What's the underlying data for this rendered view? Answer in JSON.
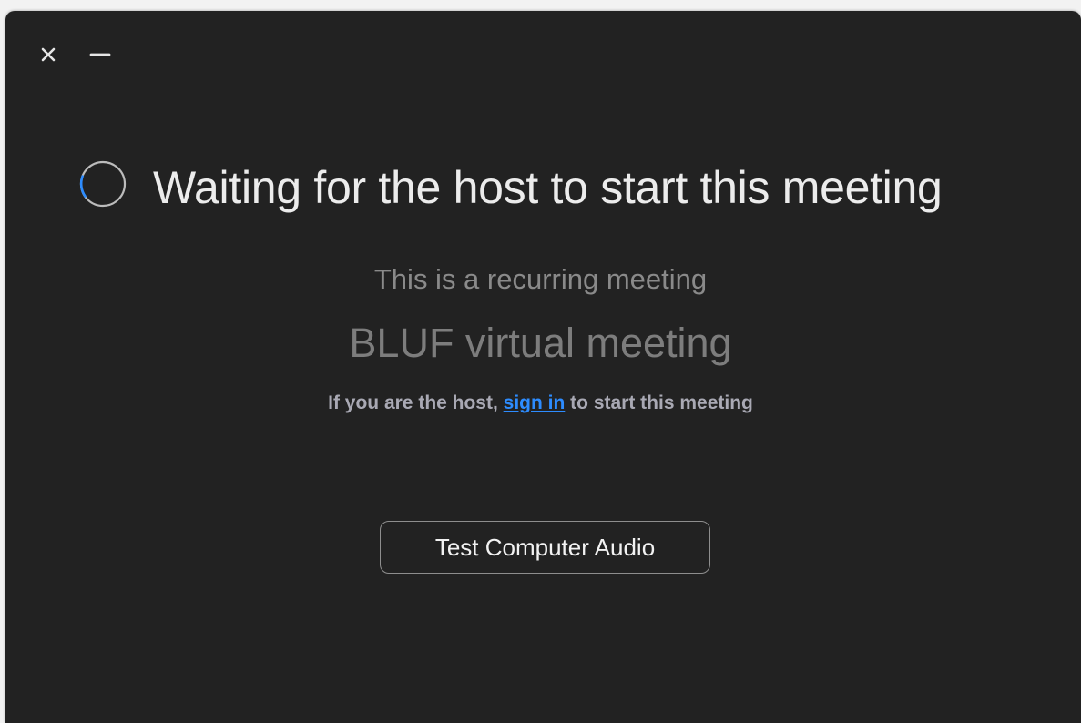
{
  "window": {
    "controls": {
      "close_icon": "close-icon",
      "minimize_icon": "minimize-icon"
    }
  },
  "main": {
    "spinner_icon": "loading-spinner-icon",
    "headline": "Waiting for the host to start this meeting",
    "recurring_text": "This is a recurring meeting",
    "meeting_name": "BLUF virtual meeting",
    "host_prefix": "If you are the host, ",
    "sign_in_link": "sign in",
    "host_suffix": " to start this meeting",
    "test_audio_button": "Test Computer Audio"
  },
  "colors": {
    "background": "#222222",
    "link": "#2d8cff",
    "spinner_accent": "#2d8cff"
  }
}
